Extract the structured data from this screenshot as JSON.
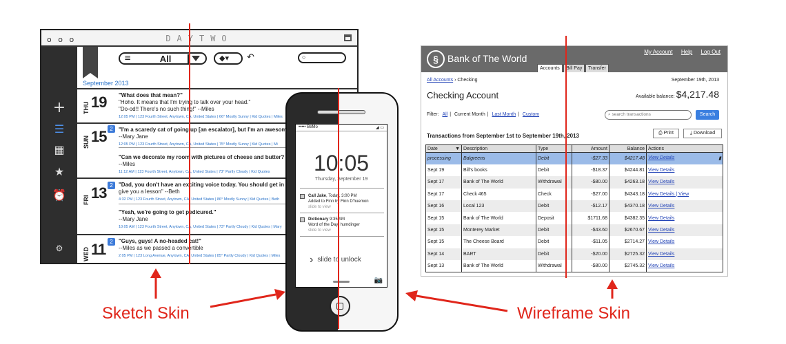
{
  "sketch": {
    "window_title": "DAYTWO",
    "window_dots": "o o o",
    "filter_label": "All",
    "month_label": "September 2013",
    "days": [
      {
        "dow": "THU",
        "num": "19",
        "badge": ""
      },
      {
        "dow": "SUN",
        "num": "15",
        "badge": "2"
      },
      {
        "dow": "FRI",
        "num": "13",
        "badge": "2"
      },
      {
        "dow": "WED",
        "num": "11",
        "badge": "2"
      }
    ],
    "entries": [
      {
        "q": "\"What does that mean?\"",
        "a": [
          "\"Hoho. It means that I'm trying to talk over your head.\"",
          "\"Do-od!! There's no such thing!\" --Miles"
        ],
        "meta": "12:05 PM  |  123 Fourth Street, Anytown, CA, United States  |  66° Mostly Sunny  |  Kid Quotes  |  Miles"
      },
      {
        "q": "\"I'm a scaredy cat of going up [an escalator], but I'm an awesome cat",
        "a": [
          "--Mary Jane"
        ],
        "meta": "12:05 PM  |  123 Fourth Street, Anytown, CA, United States  |  75° Mostly Sunny  |  Kid Quotes  |  Mi"
      },
      {
        "q": "\"Can we decorate my room with pictures of cheese and butter? But",
        "a": [
          "--Miles"
        ],
        "meta": "11:12 AM  |  123 Fourth Street, Anytown, CA, United States  |  73° Partly Cloudy  |  Kid Quotes"
      },
      {
        "q": "\"Dad, you don't have an exciting voice today. You should get in your",
        "a": [
          "give you a lesson\" --Beth"
        ],
        "meta": "4:32 PM  |  123 Fourth Street, Anytown, CA, United States  |  86° Mostly Sunny  |  Kid Quotes  |  Beth"
      },
      {
        "q": "\"Yeah, we're going to get pedicured.\"",
        "a": [
          "--Mary Jane"
        ],
        "meta": "10:05 AM  |  123 Fourth Street, Anytown, CA, United States  |  73° Partly Cloudy  |  Kid Quotes  |  Mary"
      },
      {
        "q": "\"Guys, guys! A no-headed cat!\"",
        "a": [
          "--Miles as we passed a convertible"
        ],
        "meta": "2:05 PM  |  123 Long Avenue, Anytown, CA, United States  |  85° Partly Cloudy  |  Kid Quotes  |  Miles"
      }
    ]
  },
  "phone": {
    "carrier": "BeMo",
    "time": "10:05",
    "date": "Thursday, September 19",
    "notifications": [
      {
        "title": "Call Jake",
        "time": "Today, 3:00 PM",
        "body": "Added to Finn by Finn D'huemon",
        "hint": "slide to view"
      },
      {
        "title": "Dictionary",
        "time": "9:35 AM",
        "body": "Word of the Day: humdinger",
        "hint": "slide to view"
      }
    ],
    "slide_label": "slide to unlock"
  },
  "bank": {
    "name": "Bank of The World",
    "top_links": [
      "My Account",
      "Help",
      "Log Out"
    ],
    "tabs": [
      "Accounts",
      "Bill Pay",
      "Transfer"
    ],
    "crumb_link": "All Accounts",
    "crumb_current": "Checking",
    "date": "September 19th, 2013",
    "title": "Checking Account",
    "balance_label": "Available balance:",
    "balance": "$4,217.48",
    "filter_label": "Filter:",
    "filters": [
      "All",
      "Current Month",
      "Last Month",
      "Custom"
    ],
    "search_placeholder": "search transactions",
    "search_button": "Search",
    "tx_title": "Transactions from September 1st to September 19th, 2013",
    "print_label": "Print",
    "download_label": "Download",
    "columns": [
      "Date",
      "Description",
      "Type",
      "Amount",
      "Balance",
      "Actions"
    ],
    "rows": [
      [
        "processing",
        "Balgreens",
        "Debit",
        "-$27.33",
        "$4217.48",
        "View Details"
      ],
      [
        "Sept 19",
        "Bill's books",
        "Debit",
        "-$18.37",
        "$4244.81",
        "View Details"
      ],
      [
        "Sept 17",
        "Bank of The World",
        "Withdrawal",
        "-$80.00",
        "$4263.18",
        "View Details"
      ],
      [
        "Sept 17",
        "Check 465",
        "Check",
        "-$27.00",
        "$4343.18",
        "View Details | View"
      ],
      [
        "Sept 16",
        "Local 123",
        "Debit",
        "-$12.17",
        "$4370.18",
        "View Details"
      ],
      [
        "Sept 15",
        "Bank of The World",
        "Deposit",
        "$1711.68",
        "$4382.35",
        "View Details"
      ],
      [
        "Sept 15",
        "Monterey Market",
        "Debit",
        "-$43.60",
        "$2670.67",
        "View Details"
      ],
      [
        "Sept 15",
        "The Cheese Board",
        "Debit",
        "-$11.05",
        "$2714.27",
        "View Details"
      ],
      [
        "Sept 14",
        "BART",
        "Debit",
        "-$20.00",
        "$2725.32",
        "View Details"
      ],
      [
        "Sept 13",
        "Bank of The World",
        "Withdrawal",
        "-$80.00",
        "$2745.32",
        "View Details"
      ]
    ]
  },
  "captions": {
    "sketch": "Sketch Skin",
    "wireframe": "Wireframe Skin"
  },
  "colors": {
    "accent_red": "#e0261b",
    "link_blue": "#2344b7",
    "selected_row": "#9bbbe8"
  }
}
